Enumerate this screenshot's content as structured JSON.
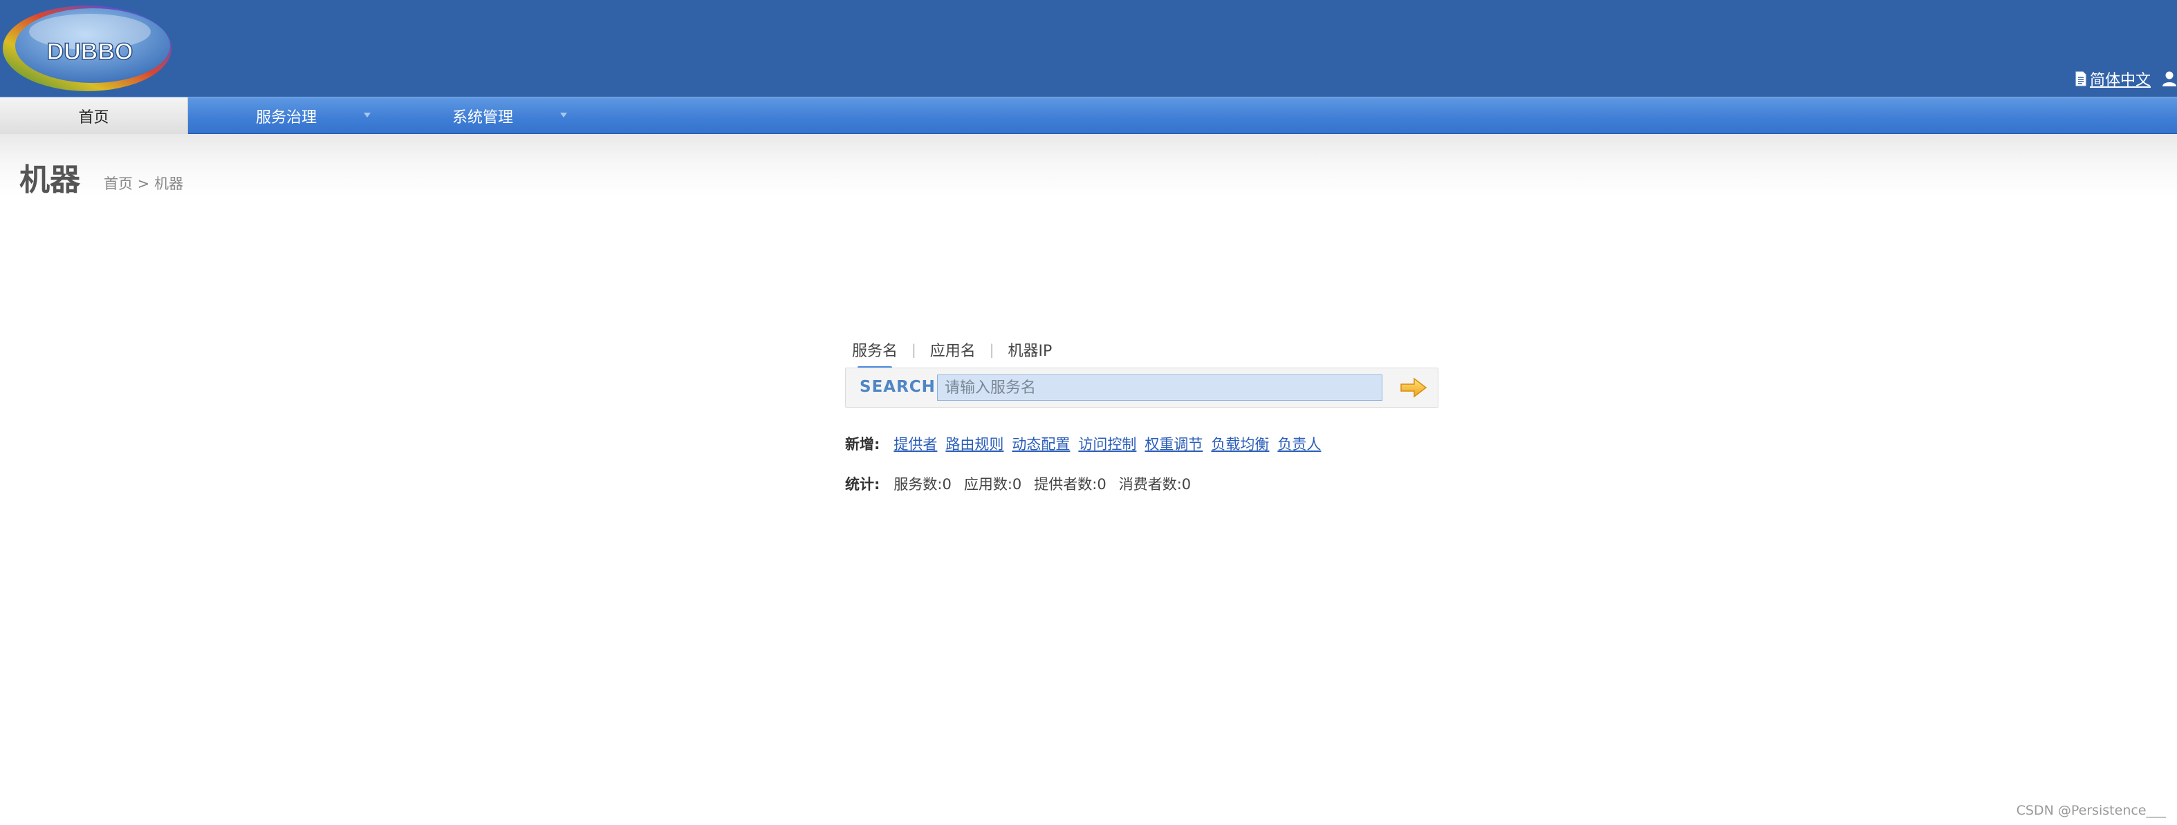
{
  "header": {
    "logo_text": "DUBBO",
    "language_link": "简体中文",
    "icons": {
      "language": "document-icon",
      "user": "user-icon"
    }
  },
  "nav": {
    "home": "首页",
    "services": "服务治理",
    "system": "系统管理"
  },
  "page": {
    "title": "机器",
    "breadcrumb": "首页 > 机器"
  },
  "search": {
    "tabs": [
      "服务名",
      "应用名",
      "机器IP"
    ],
    "active_tab": "服务名",
    "label": "SEARCH",
    "placeholder": "请输入服务名",
    "value": "",
    "go_icon": "arrow-right-icon"
  },
  "add": {
    "label": "新增:",
    "links": [
      "提供者",
      "路由规则",
      "动态配置",
      "访问控制",
      "权重调节",
      "负载均衡",
      "负责人"
    ]
  },
  "stats": {
    "label": "统计:",
    "items": [
      "服务数:0",
      "应用数:0",
      "提供者数:0",
      "消费者数:0"
    ]
  },
  "footer": {
    "watermark": "CSDN @Persistence___"
  },
  "colors": {
    "header_bg": "#3162a8",
    "nav_bg": "#3f7ed6",
    "link": "#2a5db8",
    "search_accent": "#4f86c6"
  }
}
